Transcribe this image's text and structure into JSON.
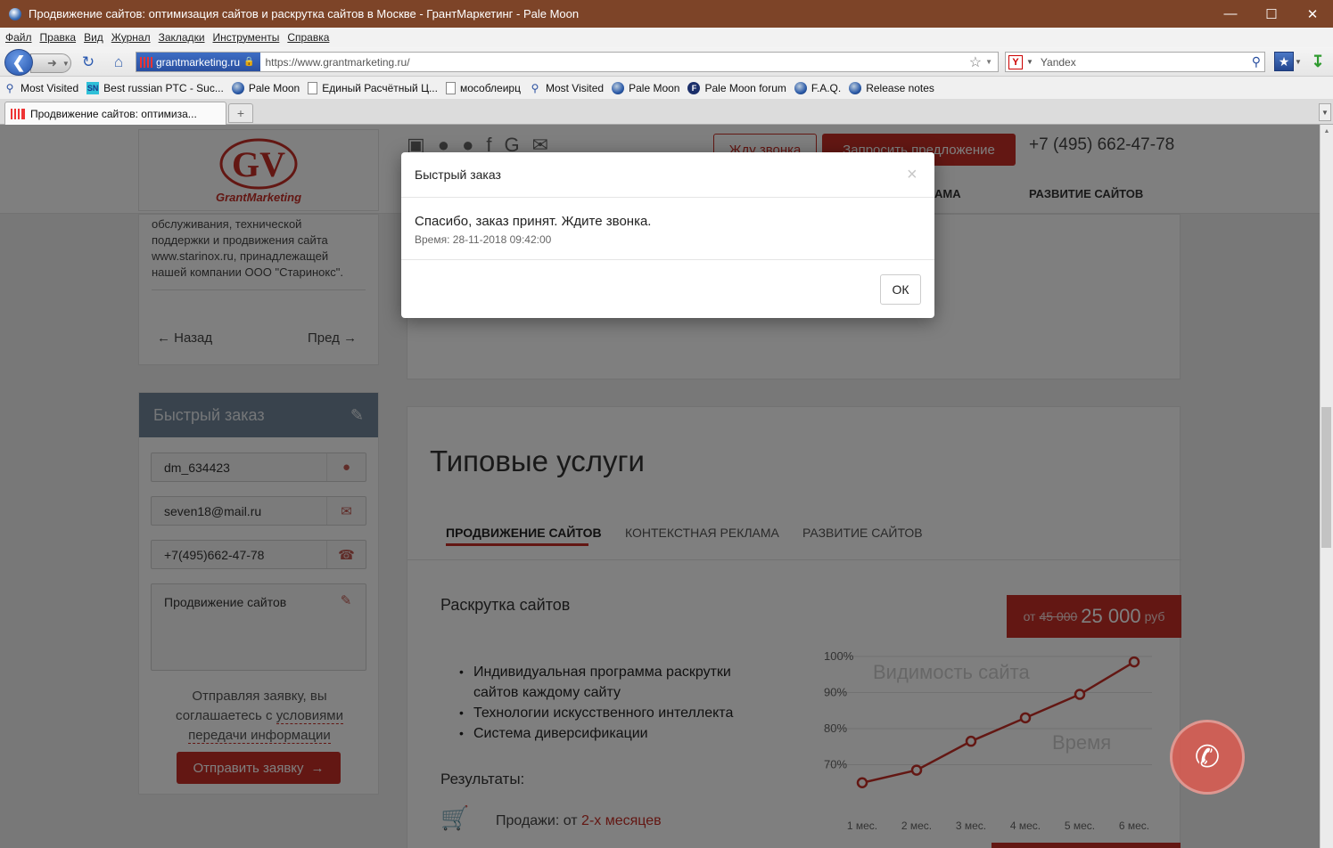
{
  "window": {
    "title": "Продвижение сайтов: оптимизация сайтов и раскрутка сайтов в Москве - ГрантМаркетинг - Pale Moon"
  },
  "menu": [
    "Файл",
    "Правка",
    "Вид",
    "Журнал",
    "Закладки",
    "Инструменты",
    "Справка"
  ],
  "navbar": {
    "site_label": "grantmarketing.ru",
    "url": "https://www.grantmarketing.ru/",
    "search_engine": "Yandex"
  },
  "bookmarks": [
    {
      "label": "Most Visited",
      "icon": "magnifier-icon"
    },
    {
      "label": "Best russian PTC - Suc...",
      "icon": "sn-icon"
    },
    {
      "label": "Pale Moon",
      "icon": "globe-icon"
    },
    {
      "label": "Единый Расчётный Ц...",
      "icon": "page-icon"
    },
    {
      "label": "мособлеирц",
      "icon": "page-icon"
    },
    {
      "label": "Most Visited",
      "icon": "magnifier-icon"
    },
    {
      "label": "Pale Moon",
      "icon": "globe-icon"
    },
    {
      "label": "Pale Moon forum",
      "icon": "forum-icon"
    },
    {
      "label": "F.A.Q.",
      "icon": "globe-icon"
    },
    {
      "label": "Release notes",
      "icon": "globe-icon"
    }
  ],
  "tab": {
    "label": "Продвижение сайтов: оптимиза..."
  },
  "site": {
    "logo_text": "GrantMarketing",
    "btn_call": "Жду звонка",
    "btn_request": "Запросить предложение",
    "phone": "+7 (495) 662-47-78",
    "nav_partial": "АМА",
    "nav_dev": "РАЗВИТИЕ САЙТОВ"
  },
  "sidebar": {
    "text_lines": [
      "обслуживания, технической",
      "поддержки и продвижения сайта",
      "www.starinox.ru, принадлежащей",
      "нашей компании ООО \"Старинокс\"."
    ],
    "back": "Назад",
    "next": "Пред"
  },
  "quick_order": {
    "title": "Быстрый заказ",
    "name": "dm_634423",
    "email": "seven18@mail.ru",
    "phone": "+7(495)662-47-78",
    "message": "Продвижение сайтов",
    "consent_1": "Отправляя заявку, вы",
    "consent_2": "соглашаетесь с",
    "consent_link1": "условиями",
    "consent_link2": "передачи информации",
    "submit": "Отправить заявку"
  },
  "services": {
    "title": "Типовые услуги",
    "tabs": [
      "ПРОДВИЖЕНИЕ САЙТОВ",
      "КОНТЕКСТНАЯ РЕКЛАМА",
      "РАЗВИТИЕ САЙТОВ"
    ],
    "subtitle": "Раскрутка сайтов",
    "price_from": "от",
    "price_old": "45 000",
    "price_new": "25 000",
    "price_unit": "руб",
    "bullets": [
      "Индивидуальная программа раскрутки",
      "сайтов каждому сайту",
      "Технологии искусственного интеллекта",
      "Система диверсификации"
    ],
    "results": "Результаты:",
    "sales_label": "Продажи: от",
    "sales_value": "2-х месяцев"
  },
  "chart_data": {
    "type": "line",
    "title": "Видимость сайта",
    "xlabel": "Время",
    "ylabel": "",
    "categories": [
      "1 мес.",
      "2 мес.",
      "3 мес.",
      "4 мес.",
      "5 мес.",
      "6 мес."
    ],
    "y_ticks": [
      "100%",
      "90%",
      "80%",
      "70%"
    ],
    "values": [
      65,
      68.5,
      76.5,
      83,
      89.5,
      98.5
    ],
    "ylim": [
      60,
      100
    ],
    "color": "#c62f27"
  },
  "modal": {
    "title": "Быстрый заказ",
    "message": "Спасибо, заказ принят. Ждите звонка.",
    "time": "Время: 28-11-2018 09:42:00",
    "ok": "ОК"
  },
  "colors": {
    "accent": "#c62f27",
    "titlebar": "#7d4428"
  }
}
